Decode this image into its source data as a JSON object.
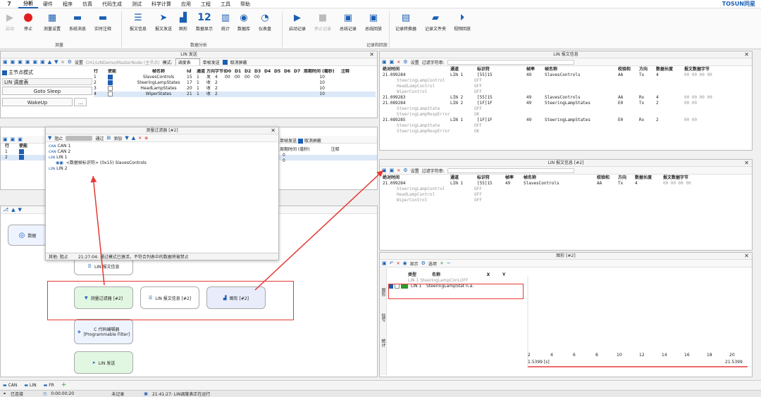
{
  "menu": {
    "logo": "7",
    "items": [
      "分析",
      "硬件",
      "程序",
      "仿真",
      "代码生成",
      "测试",
      "科学计算",
      "应用",
      "工程",
      "工具",
      "帮助"
    ],
    "brand": "TOSUN同星"
  },
  "ribbon": {
    "buttons": [
      "启动",
      "停止",
      "测量设置",
      "系统消息",
      "实时注释",
      "报文信息",
      "报文发送",
      "图形",
      "数据显示",
      "统计",
      "数据库",
      "仪表盘",
      "启动记录",
      "停止记录",
      "总线记录",
      "总线回放",
      "记录转换器",
      "记录文件夹",
      "视频回放"
    ],
    "data_display_num": "12",
    "groups": [
      "测量",
      "数据分析",
      "记录和回放"
    ]
  },
  "lin_send": {
    "title": "LIN 发送",
    "path": "CH1/LINDemo/MasterNode (主节点)",
    "mode_label": "模式:",
    "mode_value": "调度表",
    "single_send": "单帧发送",
    "cancel_all": "取消屏蔽",
    "settings": "设置",
    "master_mode": "主节点模式",
    "schedule_tab": "LIN 调度表",
    "goto_sleep": "Goto Sleep",
    "wakeup": "WakeUp",
    "more": "...",
    "headers": [
      "行",
      "使能",
      "帧名称",
      "Id",
      "通道",
      "方向",
      "字节长度",
      "D0",
      "D1",
      "D2",
      "D3",
      "D4",
      "D5",
      "D6",
      "D7",
      "周期时间 (毫秒)",
      "注释"
    ],
    "rows": [
      {
        "row": "1",
        "en": true,
        "name": "SlavesControls",
        "id": "15",
        "ch": "1",
        "dir": "发",
        "len": "4",
        "d": [
          "00",
          "00",
          "00",
          "00"
        ],
        "period": "10"
      },
      {
        "row": "2",
        "en": true,
        "name": "SteeringLampStates",
        "id": "17",
        "ch": "1",
        "dir": "收",
        "len": "2",
        "d": [],
        "period": "10"
      },
      {
        "row": "3",
        "en": false,
        "name": "HeadLampStates",
        "id": "20",
        "ch": "1",
        "dir": "收",
        "len": "2",
        "d": [],
        "period": "10"
      },
      {
        "row": "4",
        "en": false,
        "name": "WiperStates",
        "id": "21",
        "ch": "1",
        "dir": "收",
        "len": "2",
        "d": [],
        "period": "10"
      }
    ]
  },
  "second_send": {
    "headers": [
      "行",
      "使能"
    ],
    "right_headers": [
      "周期时间 (毫秒)",
      "注释"
    ],
    "single_send": "单帧发送",
    "cancel_all": "取消屏蔽",
    "rows": [
      {
        "row": "1",
        "period": "0"
      },
      {
        "row": "2",
        "period": "0"
      }
    ]
  },
  "filter": {
    "title": "测量过滤器 [#2]",
    "block": "阻止",
    "pass": "通过",
    "add": "添加",
    "tree": [
      "CAN 1",
      "CAN 2",
      "LIN 1",
      "LIN 2"
    ],
    "item": "<数据帧标识符> (0x15) SlavesControls",
    "footer_type": "其他: 阻止",
    "footer_msg": "21:27:04: 通过模式已激活，不符合列表中的数据将被禁止"
  },
  "graph_nodes": {
    "lin_msg_info": "LIN 报文信息",
    "filter": "测量过滤器 [#2]",
    "lin_msg_info2": "LIN 报文信息 [#2]",
    "graph": "图形 [#2]",
    "c_editor": "C 代码编辑器\n[Programmable Filter]",
    "lin_send": "LIN 发送",
    "data_label": "数据"
  },
  "msg_info": {
    "title": "LIN 报文信息",
    "settings": "设置",
    "filter_label": "过滤字符串:",
    "headers": [
      "绝对时间",
      "通道",
      "标识符",
      "帧率",
      "帧名称",
      "校验和",
      "方向",
      "数据长度",
      "报文数据字节"
    ],
    "frames": [
      {
        "time": "21.099284",
        "ch": "LIN 1",
        "id": "[55]15",
        "rate": "49",
        "name": "SlavesControls",
        "cs": "AA",
        "dir": "Tx",
        "len": "4",
        "data": "00 00 00 00",
        "signals": [
          [
            "SteeringLampControl",
            "OFF"
          ],
          [
            "HeadLampControl",
            "OFF"
          ],
          [
            "WiperControl",
            "OFF"
          ]
        ]
      },
      {
        "time": "21.099283",
        "ch": "LIN 2",
        "id": "[55]15",
        "rate": "49",
        "name": "SlavesControls",
        "cs": "AA",
        "dir": "Rx",
        "len": "4",
        "data": "00 00 00 00",
        "signals": []
      },
      {
        "time": "21.089284",
        "ch": "LIN 2",
        "id": "[1F]1F",
        "rate": "49",
        "name": "SteeringLampStates",
        "cs": "E0",
        "dir": "Tx",
        "len": "2",
        "data": "00 00",
        "signals": [
          [
            "SteeringLampState",
            "OFF"
          ],
          [
            "SteeringLampRespError",
            "OK"
          ]
        ]
      },
      {
        "time": "21.089285",
        "ch": "LIN 1",
        "id": "[1F]1F",
        "rate": "49",
        "name": "SteeringLampStates",
        "cs": "E0",
        "dir": "Rx",
        "len": "2",
        "data": "00 00",
        "signals": [
          [
            "SteeringLampState",
            "OFF"
          ],
          [
            "SteeringLampRespError",
            "OK"
          ]
        ]
      }
    ]
  },
  "msg_info2": {
    "title": "LIN 报文信息 [#2]",
    "settings": "设置",
    "filter_label": "过滤字符串:",
    "headers": [
      "绝对时间",
      "通道",
      "标识符",
      "帧率",
      "帧名称",
      "校验和",
      "方向",
      "数据长度",
      "报文数据字节"
    ],
    "frame": {
      "time": "21.099284",
      "ch": "LIN 1",
      "id": "[55]15",
      "rate": "49",
      "name": "SlavesControls",
      "cs": "AA",
      "dir": "Tx",
      "len": "4",
      "data": "00 00 00 00"
    },
    "signals": [
      [
        "SteeringLampControl",
        "OFF"
      ],
      [
        "HeadLampControl",
        "OFF"
      ],
      [
        "WiperControl",
        "OFF"
      ]
    ]
  },
  "graph": {
    "title": "图形 [#2]",
    "show": "显示",
    "options": "选项",
    "headers": [
      "类型",
      "名称",
      "X",
      "Y"
    ],
    "sig_top": "LIN 1 SteeringLampConLOFF",
    "sig_row": {
      "type": "LIN 1",
      "name": "SteeringLampStat",
      "x": "n.a."
    },
    "side_tabs": [
      "图形",
      "信号",
      "统计"
    ],
    "x_ticks": [
      "2",
      "4",
      "6",
      "8",
      "10",
      "12",
      "14",
      "16",
      "18",
      "20"
    ],
    "x_min": "1.5399 [s]",
    "x_max": "21.5399"
  },
  "bottom_tabs": [
    "CAN",
    "LIN",
    "FR"
  ],
  "status": {
    "conn": "已连接",
    "time": "0:00:00:20",
    "rec": "未记录",
    "msg": "21:41:27: LIN调度表正在运行"
  },
  "colors": {
    "accent": "#1a5fb4",
    "red": "#e02020",
    "frame_highlight": "#e53935"
  }
}
